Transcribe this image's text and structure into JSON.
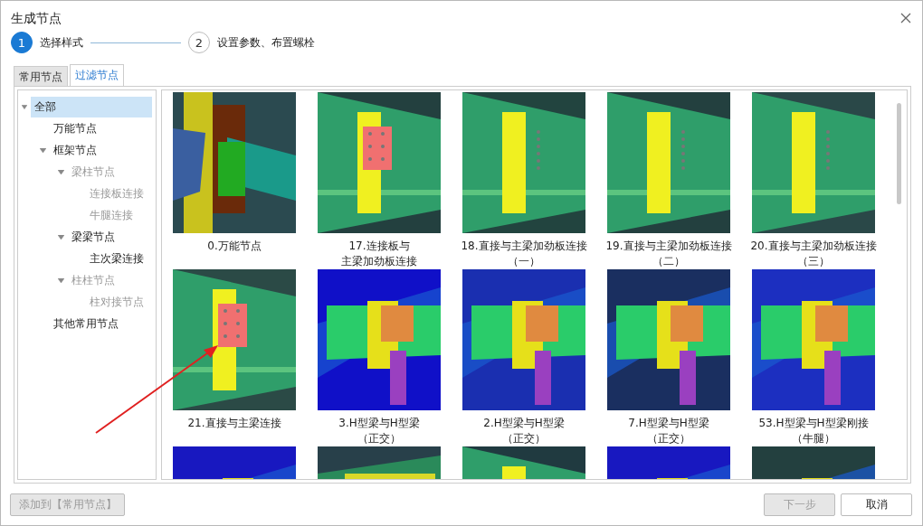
{
  "window": {
    "title": "生成节点"
  },
  "steps": [
    {
      "number": "1",
      "label": "选择样式",
      "selected": true
    },
    {
      "number": "2",
      "label": "设置参数、布置螺栓",
      "selected": false
    }
  ],
  "tabs": [
    {
      "label": "常用节点",
      "selected": false
    },
    {
      "label": "过滤节点",
      "selected": true
    }
  ],
  "tree": [
    {
      "label": "全部",
      "selected": true,
      "disabled": false,
      "expanded": true,
      "children": [
        {
          "label": "万能节点",
          "selected": false,
          "disabled": false
        },
        {
          "label": "框架节点",
          "selected": false,
          "disabled": false,
          "expanded": true,
          "children": [
            {
              "label": "梁柱节点",
              "selected": false,
              "disabled": true,
              "expanded": true,
              "children": [
                {
                  "label": "连接板连接",
                  "selected": false,
                  "disabled": true
                },
                {
                  "label": "牛腿连接",
                  "selected": false,
                  "disabled": true
                }
              ]
            },
            {
              "label": "梁梁节点",
              "selected": false,
              "disabled": false,
              "expanded": true,
              "children": [
                {
                  "label": "主次梁连接",
                  "selected": false,
                  "disabled": false
                }
              ]
            },
            {
              "label": "柱柱节点",
              "selected": false,
              "disabled": true,
              "expanded": true,
              "children": [
                {
                  "label": "柱对接节点",
                  "selected": false,
                  "disabled": true
                }
              ]
            }
          ]
        },
        {
          "label": "其他常用节点",
          "selected": false,
          "disabled": false
        }
      ]
    }
  ],
  "nodes": [
    {
      "kind": "picture",
      "lines": [
        "0.万能节点"
      ]
    },
    {
      "kind": "picture",
      "lines": [
        "17.连接板与",
        "主梁加劲板连接"
      ]
    },
    {
      "kind": "picture",
      "lines": [
        "18.直接与主梁加劲板连接",
        "（一）"
      ]
    },
    {
      "kind": "picture",
      "lines": [
        "19.直接与主梁加劲板连接",
        "（二）"
      ]
    },
    {
      "kind": "picture",
      "lines": [
        "20.直接与主梁加劲板连接",
        "（三）"
      ]
    },
    {
      "kind": "picture",
      "lines": [
        "21.直接与主梁连接"
      ]
    },
    {
      "kind": "picture",
      "lines": [
        "3.H型梁与H型梁",
        "（正交）"
      ]
    },
    {
      "kind": "picture",
      "lines": [
        "2.H型梁与H型梁",
        "（正交）"
      ]
    },
    {
      "kind": "picture",
      "lines": [
        "7.H型梁与H型梁",
        "（正交）"
      ]
    },
    {
      "kind": "picture",
      "lines": [
        "53.H型梁与H型梁刚接",
        "（牛腿）"
      ]
    },
    {
      "kind": "picture"
    },
    {
      "kind": "picture"
    },
    {
      "kind": "picture"
    },
    {
      "kind": "picture"
    },
    {
      "kind": "picture"
    }
  ],
  "buttons": [
    {
      "label": "添加到【常用节点】",
      "disabled": true
    },
    {
      "label": "下一步",
      "disabled": true
    },
    {
      "label": "取消",
      "disabled": false
    }
  ]
}
